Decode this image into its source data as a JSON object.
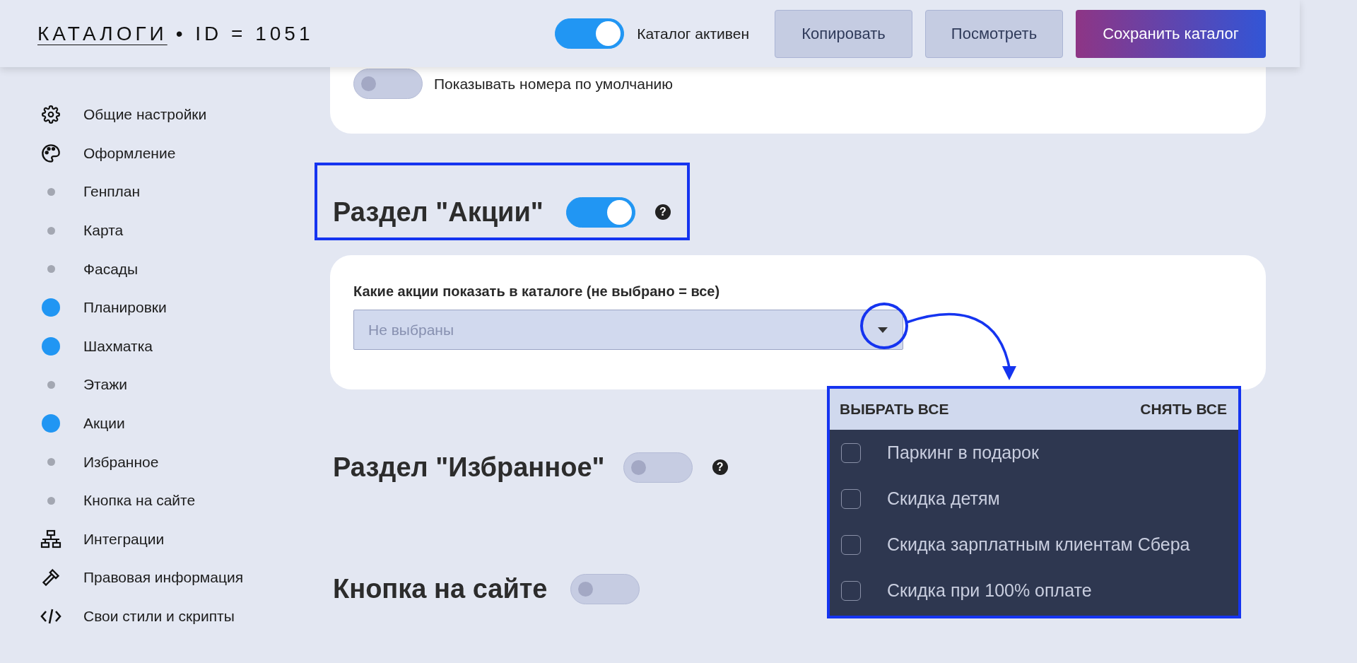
{
  "header": {
    "title_link": "КАТАЛОГИ",
    "title_rest": "• ID = 1051",
    "active_toggle": {
      "label": "Каталог активен",
      "on": true
    },
    "buttons": [
      {
        "label": "Копировать",
        "kind": "secondary"
      },
      {
        "label": "Посмотреть",
        "kind": "secondary"
      },
      {
        "label": "Сохранить каталог",
        "kind": "primary"
      }
    ]
  },
  "sidebar": {
    "items": [
      {
        "label": "Общие настройки",
        "kind": "gear"
      },
      {
        "label": "Оформление",
        "kind": "palette"
      },
      {
        "label": "Генплан",
        "kind": "dot",
        "on": false
      },
      {
        "label": "Карта",
        "kind": "dot",
        "on": false
      },
      {
        "label": "Фасады",
        "kind": "dot",
        "on": false
      },
      {
        "label": "Планировки",
        "kind": "dot",
        "on": true
      },
      {
        "label": "Шахматка",
        "kind": "dot",
        "on": true
      },
      {
        "label": "Этажи",
        "kind": "dot",
        "on": false
      },
      {
        "label": "Акции",
        "kind": "dot",
        "on": true
      },
      {
        "label": "Избранное",
        "kind": "dot",
        "on": false
      },
      {
        "label": "Кнопка на сайте",
        "kind": "dot",
        "on": false
      },
      {
        "label": "Интеграции",
        "kind": "network"
      },
      {
        "label": "Правовая информация",
        "kind": "gavel"
      },
      {
        "label": "Свои стили и скрипты",
        "kind": "code"
      }
    ]
  },
  "top_card": {
    "toggle": {
      "label": "Показывать номера по умолчанию",
      "on": false
    }
  },
  "sections": [
    {
      "title": "Раздел \"Акции\"",
      "on": true,
      "help": "?",
      "highlighted": true,
      "field": {
        "label": "Какие акции показать в каталоге (не выбрано = все)",
        "placeholder": "Не выбраны"
      }
    },
    {
      "title": "Раздел \"Избранное\"",
      "on": false,
      "help": "?",
      "highlighted": false
    },
    {
      "title": "Кнопка на сайте",
      "on": false,
      "highlighted": false
    }
  ],
  "dropdown": {
    "select_all": "ВЫБРАТЬ ВСЕ",
    "clear_all": "СНЯТЬ ВСЕ",
    "options": [
      {
        "label": "Паркинг в подарок",
        "checked": false
      },
      {
        "label": "Скидка детям",
        "checked": false
      },
      {
        "label": "Скидка зарплатным клиентам Сбера",
        "checked": false
      },
      {
        "label": "Скидка при 100% оплате",
        "checked": false
      }
    ]
  }
}
